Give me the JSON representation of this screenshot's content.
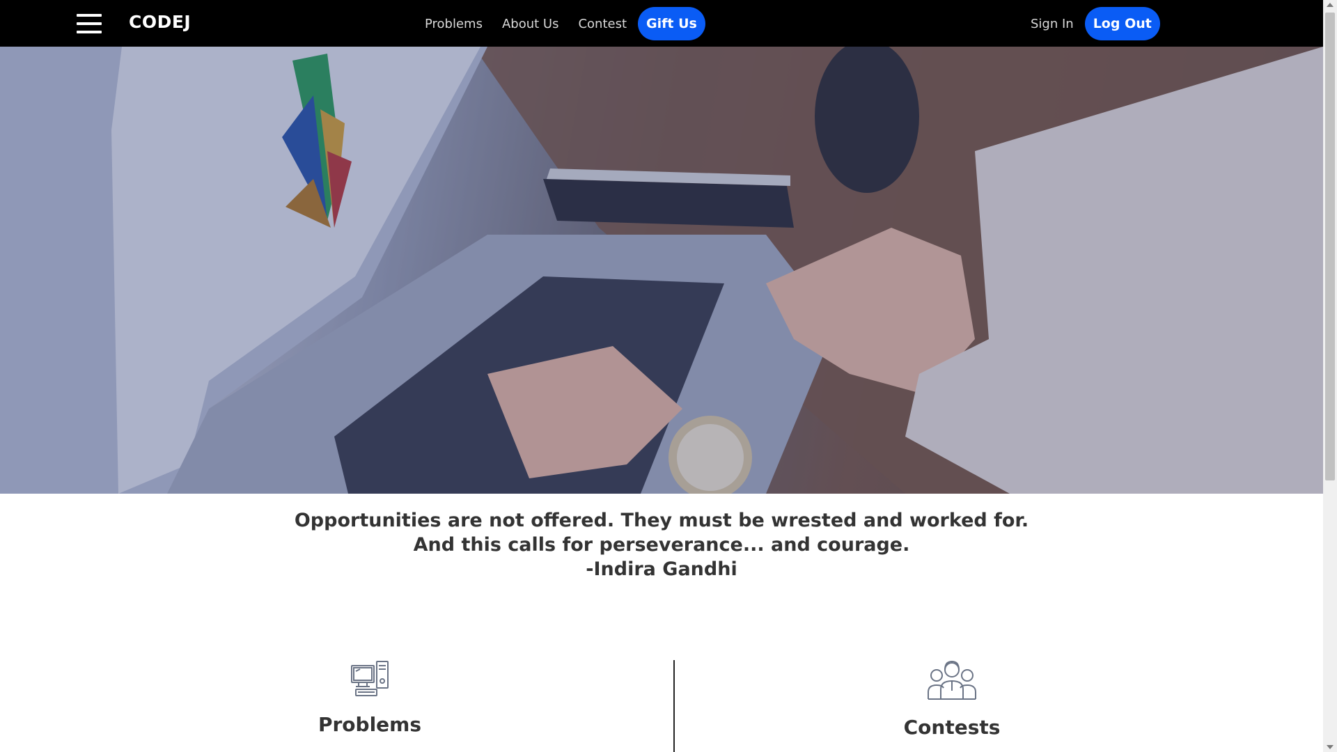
{
  "nav": {
    "brand": "CODEJ",
    "links": [
      "Problems",
      "About Us",
      "Contest"
    ],
    "gift_label": "Gift Us",
    "sign_in_label": "Sign In",
    "log_out_label": "Log Out",
    "accent_color": "#0a5cf5"
  },
  "quote": {
    "line1": "Opportunities are not offered. They must be wrested and worked for.",
    "line2": "And this calls for perseverance... and courage.",
    "author": "-Indira Gandhi"
  },
  "features": {
    "problems": {
      "label": "Problems",
      "icon": "computer-icon"
    },
    "contests": {
      "label": "Contests",
      "icon": "users-group-icon"
    }
  }
}
